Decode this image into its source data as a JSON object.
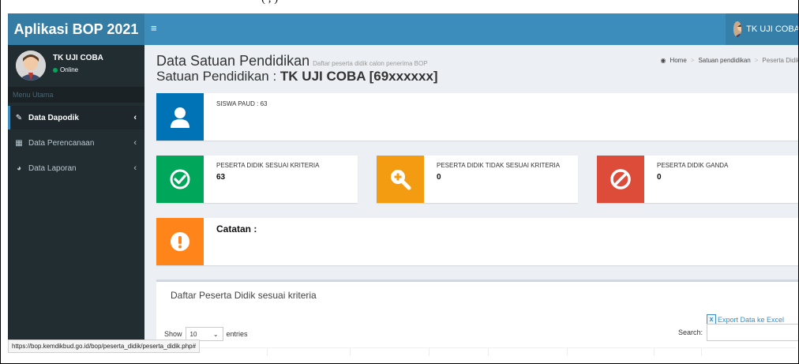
{
  "top_strip_text": "(                    ,         )",
  "brand": "Aplikasi BOP 2021",
  "navbar": {
    "toggle": "≡",
    "user_name": "TK UJI COBA"
  },
  "sidebar": {
    "user_name": "TK UJI COBA",
    "user_status": "Online",
    "menu_header": "Menu Utama",
    "items": [
      {
        "label": "Data Dapodik",
        "icon": "edit-icon",
        "chev": "‹"
      },
      {
        "label": "Data Perencanaan",
        "icon": "table-icon",
        "chev": "‹"
      },
      {
        "label": "Data Laporan",
        "icon": "globe-icon",
        "chev": "‹"
      }
    ]
  },
  "content": {
    "title": "Data Satuan Pendidikan",
    "title_small": "Daftar peserta didik calon penerima BOP",
    "subtitle_prefix": "Satuan Pendidikan : ",
    "subtitle_value": "TK UJI COBA [69xxxxxx]",
    "breadcrumb": {
      "home": "Home",
      "sep": ">",
      "level2": "Satuan pendidikan",
      "level3": "Peserta Didik"
    }
  },
  "info_boxes": {
    "siswa": {
      "text": "SISWA PAUD : 63",
      "color": "#0073b7"
    },
    "sesuai": {
      "text": "PESERTA DIDIK SESUAI KRITERIA",
      "value": "63",
      "color": "#00a65a"
    },
    "tidak_sesuai": {
      "text": "PESERTA DIDIK TIDAK SESUAI KRITERIA",
      "value": "0",
      "color": "#f39c12"
    },
    "ganda": {
      "text": "PESERTA DIDIK GANDA",
      "value": "0",
      "color": "#dd4b39"
    },
    "catatan": {
      "text": "Catatan :",
      "color": "#ff851b"
    }
  },
  "list": {
    "title": "Daftar Peserta Didik sesuai kriteria",
    "export_label": "Export Data ke Excel",
    "show_label": "Show",
    "length_value": "10",
    "entries_label": "entries",
    "search_label": "Search:"
  },
  "status_url": "https://bop.kemdikbud.go.id/bop/peserta_didik/peserta_didik.php#"
}
